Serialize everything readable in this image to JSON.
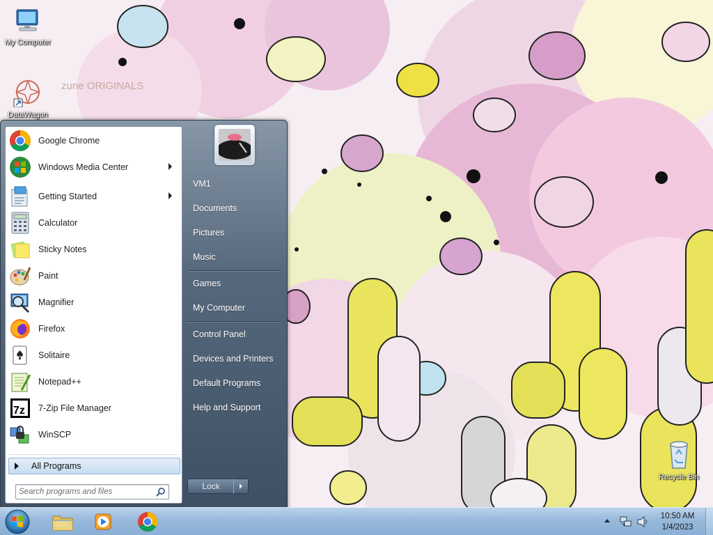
{
  "desktop": {
    "icons": [
      {
        "name": "my-computer",
        "label": "My Computer"
      },
      {
        "name": "data-wagon",
        "label": "DataWagon"
      },
      {
        "name": "recycle-bin",
        "label": "Recycle Bin"
      }
    ],
    "wallpaper_watermark": "zune ORIGINALS"
  },
  "start_menu": {
    "programs": [
      {
        "label": "Google Chrome",
        "icon": "chrome-icon",
        "submenu": false
      },
      {
        "label": "Windows Media Center",
        "icon": "media-center-icon",
        "submenu": true
      },
      {
        "label": "Getting Started",
        "icon": "getting-started-icon",
        "submenu": true
      },
      {
        "label": "Calculator",
        "icon": "calculator-icon",
        "submenu": false
      },
      {
        "label": "Sticky Notes",
        "icon": "sticky-notes-icon",
        "submenu": false
      },
      {
        "label": "Paint",
        "icon": "paint-icon",
        "submenu": false
      },
      {
        "label": "Magnifier",
        "icon": "magnifier-icon",
        "submenu": false
      },
      {
        "label": "Firefox",
        "icon": "firefox-icon",
        "submenu": false
      },
      {
        "label": "Solitaire",
        "icon": "solitaire-icon",
        "submenu": false
      },
      {
        "label": "Notepad++",
        "icon": "notepadpp-icon",
        "submenu": false
      },
      {
        "label": "7-Zip File Manager",
        "icon": "7zip-icon",
        "submenu": false
      },
      {
        "label": "WinSCP",
        "icon": "winscp-icon",
        "submenu": false
      }
    ],
    "all_programs": "All Programs",
    "search": {
      "placeholder": "Search programs and files"
    },
    "right_items": [
      {
        "label": "VM1"
      },
      {
        "label": "Documents"
      },
      {
        "label": "Pictures"
      },
      {
        "label": "Music"
      },
      {
        "label": "Games"
      },
      {
        "label": "My Computer"
      },
      {
        "label": "Control Panel"
      },
      {
        "label": "Devices and Printers"
      },
      {
        "label": "Default Programs"
      },
      {
        "label": "Help and Support"
      }
    ],
    "shutdown": {
      "label": "Lock"
    }
  },
  "taskbar": {
    "pinned": [
      {
        "name": "explorer-icon"
      },
      {
        "name": "media-player-icon"
      },
      {
        "name": "chrome-icon"
      }
    ],
    "clock": {
      "time": "10:50 AM",
      "date": "1/4/2023"
    }
  },
  "colors": {
    "taskbar": "#97b8da",
    "start_menu_right": "#56687c",
    "all_programs_highlight": "#c6dcf2"
  }
}
